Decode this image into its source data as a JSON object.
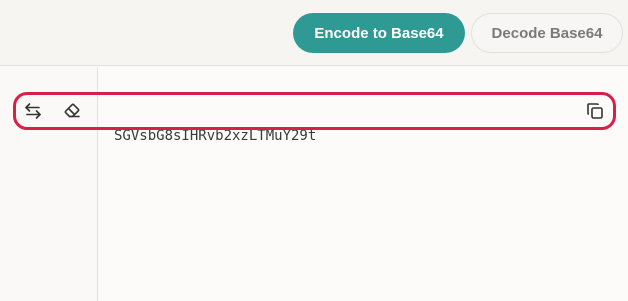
{
  "header": {
    "encode_label": "Encode to Base64",
    "decode_label": "Decode Base64"
  },
  "toolbar": {
    "icons": [
      "swap-icon",
      "eraser-icon",
      "copy-icon"
    ]
  },
  "output": {
    "text": "SGVsbG8sIHRvb2xzLTMuY29t"
  },
  "colors": {
    "accent": "#2f9a94",
    "highlight": "#d81f4a"
  }
}
